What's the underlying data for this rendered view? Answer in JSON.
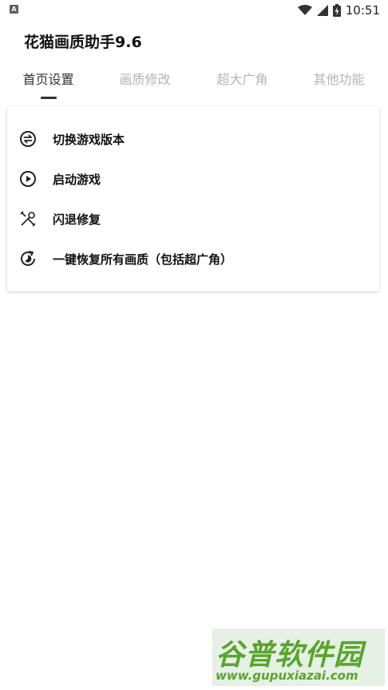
{
  "status_bar": {
    "notification_badge": "A",
    "time": "10:51",
    "icons": [
      "wifi-icon",
      "signal-icon",
      "battery-icon"
    ]
  },
  "app": {
    "title": "花猫画质助手9.6"
  },
  "tabs": [
    {
      "label": "首页设置",
      "active": true
    },
    {
      "label": "画质修改",
      "active": false
    },
    {
      "label": "超大广角",
      "active": false
    },
    {
      "label": "其他功能",
      "active": false
    }
  ],
  "menu": {
    "items": [
      {
        "label": "切换游戏版本",
        "icon": "switch-version-icon"
      },
      {
        "label": "启动游戏",
        "icon": "play-icon"
      },
      {
        "label": "闪退修复",
        "icon": "tools-icon"
      },
      {
        "label": "一键恢复所有画质（包括超广角）",
        "icon": "restore-icon"
      }
    ]
  },
  "watermark": {
    "name": "谷普软件园",
    "url": "www.gupuxiazai.com"
  },
  "colors": {
    "tab_active": "#333333",
    "tab_inactive": "#b4b4b4",
    "watermark_green": "#58a52d"
  }
}
